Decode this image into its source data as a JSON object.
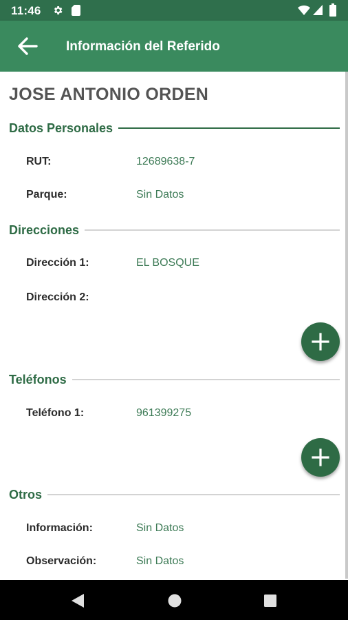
{
  "status_bar": {
    "time": "11:46",
    "icons": [
      "gear-icon",
      "sd-card-icon",
      "wifi-icon",
      "signal-icon",
      "battery-icon"
    ]
  },
  "app_bar": {
    "back_icon": "arrow-back-icon",
    "title": "Información del Referido"
  },
  "person": {
    "name": "JOSE ANTONIO ORDEN"
  },
  "sections": {
    "personal": {
      "title": "Datos Personales",
      "rows": [
        {
          "label": "RUT:",
          "value": "12689638-7"
        },
        {
          "label": "Parque:",
          "value": "Sin Datos"
        }
      ]
    },
    "addresses": {
      "title": "Direcciones",
      "rows": [
        {
          "label": "Dirección 1:",
          "value": "EL BOSQUE"
        },
        {
          "label": "Dirección 2:",
          "value": ""
        }
      ]
    },
    "phones": {
      "title": "Teléfonos",
      "rows": [
        {
          "label": "Teléfono 1:",
          "value": "961399275"
        }
      ]
    },
    "others": {
      "title": "Otros",
      "rows": [
        {
          "label": "Información:",
          "value": "Sin Datos"
        },
        {
          "label": "Observación:",
          "value": "Sin Datos"
        }
      ]
    }
  },
  "fab_icon": "plus-icon",
  "colors": {
    "status_bar": "#2f6f4c",
    "app_bar": "#3a8a5e",
    "accent": "#2e6b45",
    "value_text": "#3c7a55",
    "divider": "#d3d3d3"
  },
  "nav_bar": {
    "icons": [
      "nav-back-icon",
      "nav-home-icon",
      "nav-recents-icon"
    ]
  }
}
